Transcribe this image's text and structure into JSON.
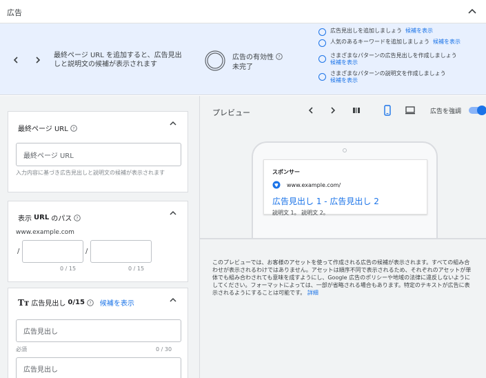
{
  "header": {
    "title": "広告"
  },
  "banner": {
    "message": "最終ページ URL を追加すると、広告見出しと説明文の候補が表示されます",
    "effectiveness_title": "広告の有効性",
    "effectiveness_status": "未完了",
    "suggestions": [
      {
        "text": "広告見出しを追加しましょう",
        "link": "候補を表示"
      },
      {
        "text": "人気のあるキーワードを追加しましょう",
        "link": "候補を表示"
      },
      {
        "text": "さまざまなパターンの広告見出しを作成しましょう",
        "link": "候補を表示"
      },
      {
        "text": "さまざまなパターンの説明文を作成しましょう",
        "link": "候補を表示"
      }
    ]
  },
  "final_url": {
    "title": "最終ページ URL",
    "placeholder": "最終ページ URL",
    "hint": "入力内容に基づき広告見出しと説明文の候補が表示されます"
  },
  "display_path": {
    "title_prefix": "表示",
    "title_bold": "URL",
    "title_suffix": "のパス",
    "domain": "www.example.com",
    "slash": "/",
    "path1_count": "0 / 15",
    "path2_count": "0 / 15"
  },
  "headlines": {
    "title": "広告見出し",
    "count": "0/15",
    "suggest_link": "候補を表示",
    "input1_placeholder": "広告見出し",
    "input1_hint": "必須",
    "input1_count": "0 / 30",
    "input2_placeholder": "広告見出し"
  },
  "preview": {
    "label": "プレビュー",
    "emphasize_label": "広告を強調",
    "emphasize_on": true,
    "ad": {
      "sponsor": "スポンサー",
      "url": "www.example.com/",
      "headline": "広告見出し 1 - 広告見出し 2",
      "description": "説明文 1。 説明文 2。"
    },
    "note": "このプレビューでは、お客様のアセットを使って作成される広告の候補が表示されます。すべての組み合わせが表示されるわけではありません。アセットは順序不同で表示されるため、それぞれのアセットが単体でも組み合わされても意味を成すようにし、Google 広告のポリシーや地域の法律に違反しないようにしてください。フォーマットによっては、一部が省略される場合もあります。特定のテキストが広告に表示されるようにすることは可能です。",
    "note_link": "詳細"
  },
  "colors": {
    "accent": "#1a73e8",
    "banner_bg": "#e8f0fe",
    "pane_bg": "#f1f3f4"
  }
}
